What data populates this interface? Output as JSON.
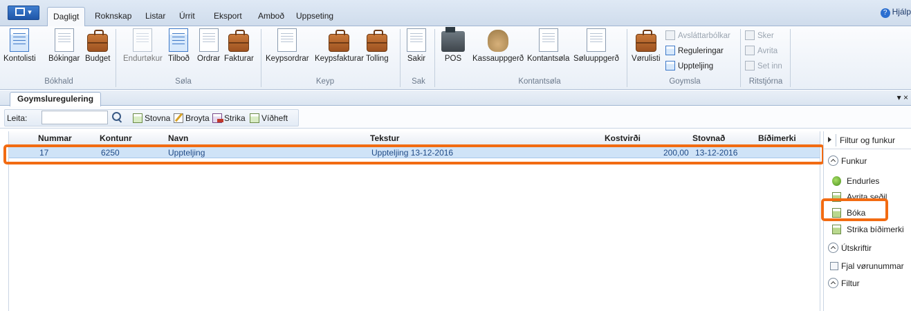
{
  "menu": {
    "tabs": [
      "Dagligt",
      "Roknskap",
      "Listar",
      "Úrrit",
      "Eksport",
      "Amboð",
      "Uppseting"
    ],
    "help_label": "Hjálp"
  },
  "ribbon": {
    "groups": {
      "bokhald": {
        "label": "Bókhald",
        "buttons": [
          "Kontolisti",
          "Bókingar",
          "Budget"
        ]
      },
      "sola": {
        "label": "Søla",
        "buttons": [
          "Endurtøkur",
          "Tilboð",
          "Ordrar",
          "Fakturar"
        ]
      },
      "keyp": {
        "label": "Keyp",
        "buttons": [
          "Keypsordrar",
          "Keypsfakturar",
          "Tolling"
        ]
      },
      "sak": {
        "label": "Sak",
        "buttons": [
          "Sakir"
        ]
      },
      "kontantsola": {
        "label": "Kontantsøla",
        "buttons": [
          "POS",
          "Kassauppgerð",
          "Kontantsøla",
          "Søluuppgerð"
        ]
      },
      "goymsla": {
        "label": "Goymsla",
        "big_button": "Vørulisti",
        "small_buttons": [
          "Avsláttarbólkar",
          "Reguleringar",
          "Uppteljing"
        ]
      },
      "ritstjorna": {
        "label": "Ritstjórna",
        "small_buttons": [
          "Sker",
          "Avrita",
          "Set inn"
        ]
      }
    }
  },
  "document_tab": {
    "label": "Goymsluregulering",
    "menu_glyph": "▾ ×"
  },
  "toolbar": {
    "search_label": "Leita:",
    "search_value": "",
    "buttons": [
      "Stovna",
      "Broyta",
      "Strika",
      "Víðheft"
    ]
  },
  "grid": {
    "columns": [
      "Nummar",
      "Kontunr",
      "Navn",
      "Tekstur",
      "Kostvirði",
      "Stovnað",
      "Bíðimerki"
    ],
    "rows": [
      {
        "nummar": "17",
        "kontunr": "6250",
        "navn": "Uppteljing",
        "tekstur": "Uppteljing 13-12-2016",
        "kostvirdi": "200,00",
        "stovnad": "13-12-2016",
        "bidimerki": ""
      }
    ]
  },
  "side_panel": {
    "header": "Filtur og funkur",
    "sections": {
      "funkur": {
        "label": "Funkur",
        "items": [
          "Endurles",
          "Avrita seðil",
          "Bóka",
          "Strika bíðimerki"
        ]
      },
      "utskriftir": {
        "label": "Útskriftir",
        "checkbox": "Fjal vørunummar"
      },
      "filtur": {
        "label": "Filtur"
      }
    }
  },
  "colors": {
    "highlight": "#f26b12",
    "selected_row": "#cfe3f7",
    "ribbon_accent": "#1f56a8"
  }
}
